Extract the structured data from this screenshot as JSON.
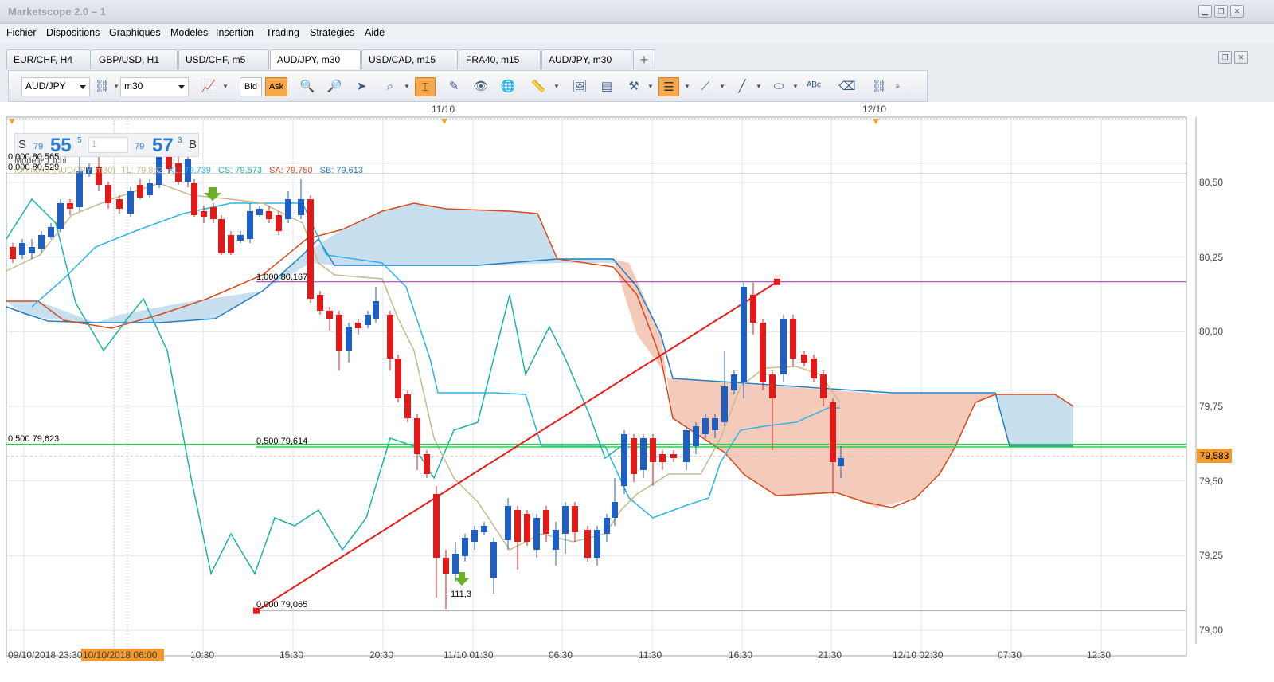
{
  "window": {
    "title": "Marketscope 2.0 – 1"
  },
  "menu": [
    "Fichier",
    "Dispositions",
    "Graphiques",
    "Modeles",
    "Insertion",
    "Trading",
    "Strategies",
    "Aide"
  ],
  "tabs": [
    {
      "label": "EUR/CHF, H4",
      "active": false
    },
    {
      "label": "GBP/USD, H1",
      "active": false
    },
    {
      "label": "USD/CHF, m5",
      "active": false
    },
    {
      "label": "AUD/JPY, m30",
      "active": true
    },
    {
      "label": "USD/CAD, m15",
      "active": false
    },
    {
      "label": "FRA40, m15",
      "active": false
    },
    {
      "label": "AUD/JPY, m30",
      "active": false
    }
  ],
  "tab_add": "+",
  "toolbar": {
    "symbol": "AUD/JPY",
    "timeframe": "m30",
    "bid_label": "Bid",
    "ask_label": "Ask",
    "active_price": "Ask"
  },
  "pricebox": {
    "sell_label": "S",
    "sell_prefix": "79",
    "sell_big": "55",
    "sell_sup": "5",
    "qty_placeholder": "1",
    "buy_prefix": "79",
    "buy_big": "57",
    "buy_sup": "3",
    "buy_label": "B"
  },
  "indicator_legend": {
    "name": "Ichimoku (AUD/JPY, m30)",
    "tl": "TL: 79,862",
    "kl": "KL: 79,739",
    "cs": "CS: 79,573",
    "sa": "SA: 79,750",
    "sb": "SB: 79,613"
  },
  "overlay_labels": {
    "top1": "0,000 80,565",
    "top2": "0,000 80,529",
    "model": "Modele 1 Ichi",
    "fib_top": "1,000 80,167",
    "fib_mid_left": "0,500 79,623",
    "fib_mid": "0,500 79,614",
    "fib_bottom": "0,000 79,065",
    "signal": "111,3"
  },
  "date_markers": [
    "11/10",
    "12/10"
  ],
  "price_axis": [
    "80,50",
    "80,25",
    "80,00",
    "79,75",
    "79,50",
    "79,25",
    "79,00"
  ],
  "current_price": "79,583",
  "time_axis": [
    "09/10/2018 23:30",
    "10/10/2018 06:00",
    "10:30",
    "15:30",
    "20:30",
    "11/10 01:30",
    "06:30",
    "11:30",
    "16:30",
    "21:30",
    "12/10 02:30",
    "07:30",
    "12:30"
  ],
  "colors": {
    "bull": "#1f5fbf",
    "bear": "#e01919",
    "tenkan": "#29b5e8",
    "kijun": "#1bb3a8",
    "chikou": "#c9b98a",
    "senkou_a": "#d9491c",
    "senkou_b": "#1f7fc6",
    "cloud_bull": "#c7dfee",
    "cloud_bear": "#f4cbbb",
    "fib_line": "#9e26a6",
    "mid_line": "#27d14a",
    "trend_line": "#ea1a1a",
    "current_price_bg": "#f29a2e"
  },
  "chart_data": {
    "type": "candlestick",
    "instrument": "AUD/JPY",
    "timeframe": "m30",
    "ylim": [
      79.0,
      80.7
    ],
    "current_price": 79.583,
    "ichimoku": {
      "tenkan": 79.862,
      "kijun": 79.739,
      "chikou": 79.573,
      "senkou_a": 79.75,
      "senkou_b": 79.613
    },
    "fibonacci": [
      {
        "level": 1.0,
        "price": 80.167
      },
      {
        "level": 0.5,
        "price": 79.614
      },
      {
        "level": 0.0,
        "price": 79.065
      }
    ],
    "horizontal_levels": [
      80.565,
      80.529,
      79.623
    ]
  }
}
